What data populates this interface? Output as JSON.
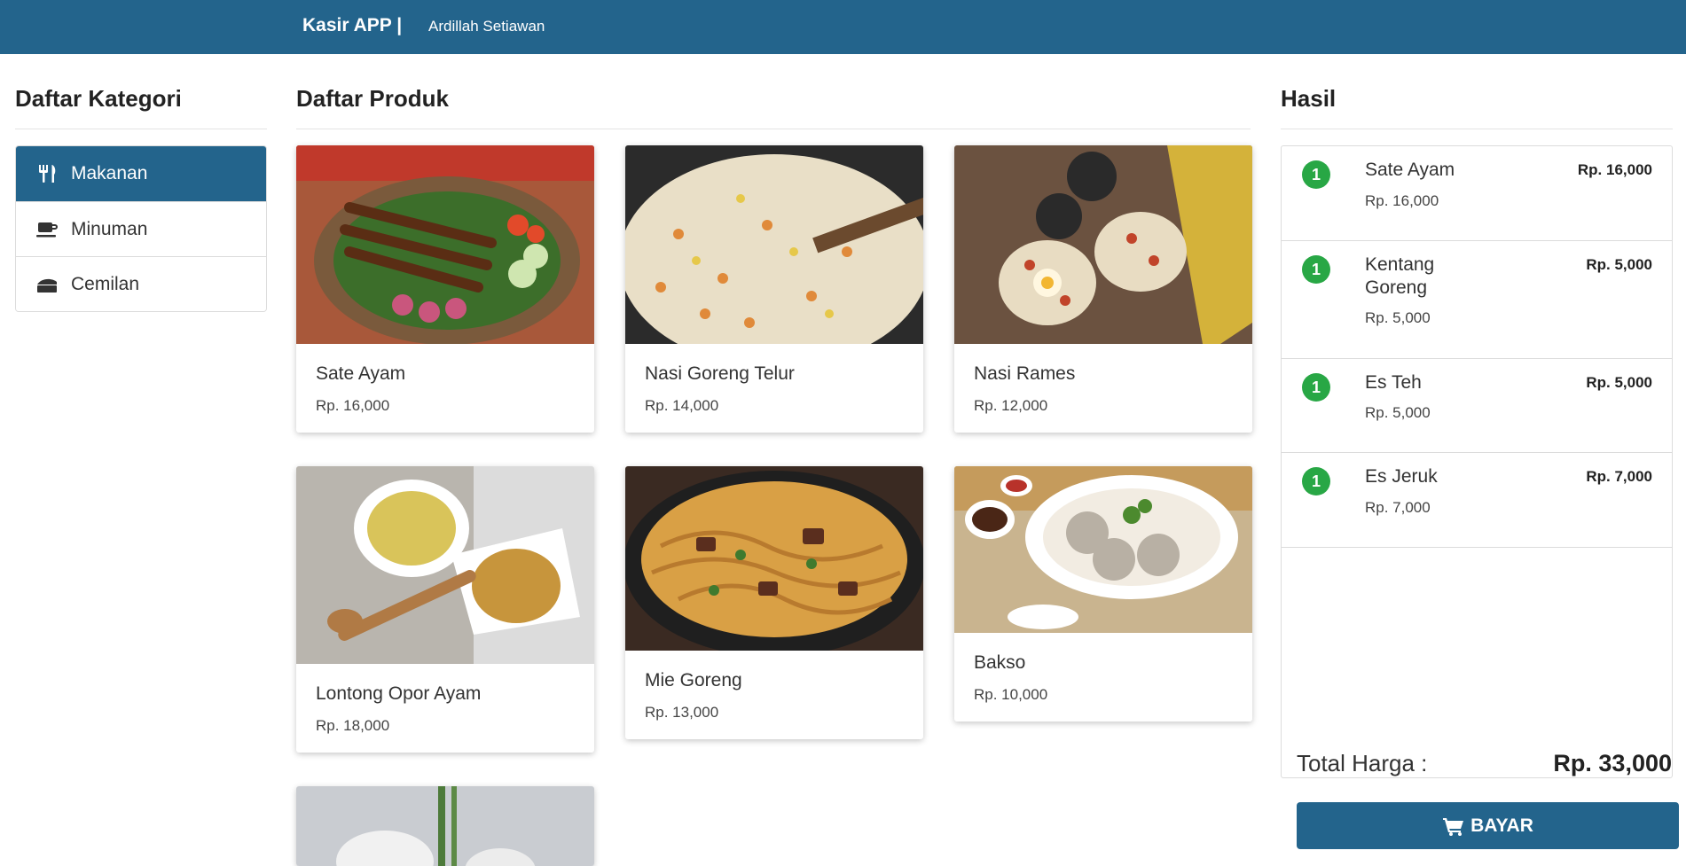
{
  "navbar": {
    "brand": "Kasir APP |",
    "user": "Ardillah Setiawan"
  },
  "categories": {
    "title": "Daftar Kategori",
    "items": [
      {
        "label": "Makanan",
        "icon": "utensils-icon",
        "active": true
      },
      {
        "label": "Minuman",
        "icon": "coffee-icon",
        "active": false
      },
      {
        "label": "Cemilan",
        "icon": "cheese-icon",
        "active": false
      }
    ]
  },
  "products": {
    "title": "Daftar Produk",
    "items": [
      {
        "name": "Sate Ayam",
        "price": "Rp. 16,000",
        "image": "sate-ayam-photo"
      },
      {
        "name": "Nasi Goreng Telur",
        "price": "Rp. 14,000",
        "image": "nasi-goreng-photo"
      },
      {
        "name": "Nasi Rames",
        "price": "Rp. 12,000",
        "image": "nasi-rames-photo"
      },
      {
        "name": "Lontong Opor Ayam",
        "price": "Rp. 18,000",
        "image": "lontong-opor-photo"
      },
      {
        "name": "Mie Goreng",
        "price": "Rp. 13,000",
        "image": "mie-goreng-photo"
      },
      {
        "name": "Bakso",
        "price": "Rp. 10,000",
        "image": "bakso-photo"
      }
    ]
  },
  "result": {
    "title": "Hasil",
    "items": [
      {
        "qty": "1",
        "name": "Sate Ayam",
        "unit_price": "Rp. 16,000",
        "total": "Rp. 16,000"
      },
      {
        "qty": "1",
        "name": "Kentang Goreng",
        "unit_price": "Rp. 5,000",
        "total": "Rp. 5,000"
      },
      {
        "qty": "1",
        "name": "Es Teh",
        "unit_price": "Rp. 5,000",
        "total": "Rp. 5,000"
      },
      {
        "qty": "1",
        "name": "Es Jeruk",
        "unit_price": "Rp. 7,000",
        "total": "Rp. 7,000"
      }
    ],
    "total_label": "Total Harga :",
    "total_value": "Rp. 33,000",
    "pay_label": "BAYAR"
  },
  "colors": {
    "primary": "#23648c",
    "badge": "#28a745"
  }
}
